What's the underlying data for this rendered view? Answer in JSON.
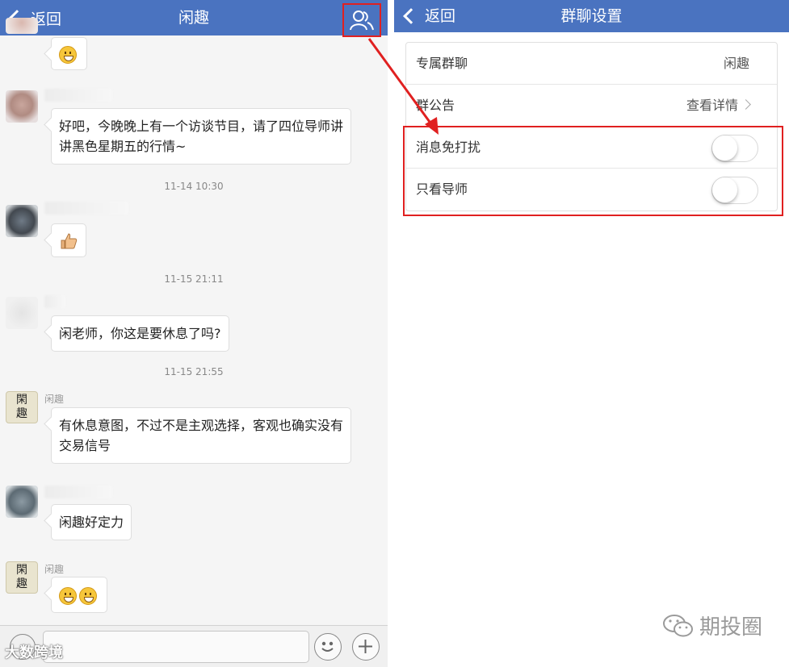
{
  "colors": {
    "navbar": "#4a73c0",
    "highlight": "#e02020"
  },
  "left": {
    "back_label": "返回",
    "title": "闲趣",
    "group_icon": "group-members-icon",
    "messages": [
      {
        "text": "好吧，今晚晚上有一个访谈节目，请了四位导师讲讲黑色星期五的行情~"
      },
      {
        "timestamp": "11-14 10:30"
      },
      {
        "timestamp": "11-15 21:11"
      },
      {
        "text": "闲老师，你这是要休息了吗?"
      },
      {
        "timestamp": "11-15 21:55"
      },
      {
        "sender": "闲趣",
        "text": "有休息意图，不过不是主观选择，客观也确实没有交易信号"
      },
      {
        "text": "闲趣好定力"
      },
      {
        "sender": "闲趣"
      }
    ],
    "avatar_glyph": "閑趣",
    "watermark": "大数跨境"
  },
  "right": {
    "back_label": "返回",
    "title": "群聊设置",
    "rows": [
      {
        "label": "专属群聊",
        "value": "闲趣"
      },
      {
        "label": "群公告",
        "value": "查看详情"
      },
      {
        "label": "消息免打扰",
        "toggle": false
      },
      {
        "label": "只看导师",
        "toggle": false
      }
    ],
    "watermark": "期投圈"
  }
}
